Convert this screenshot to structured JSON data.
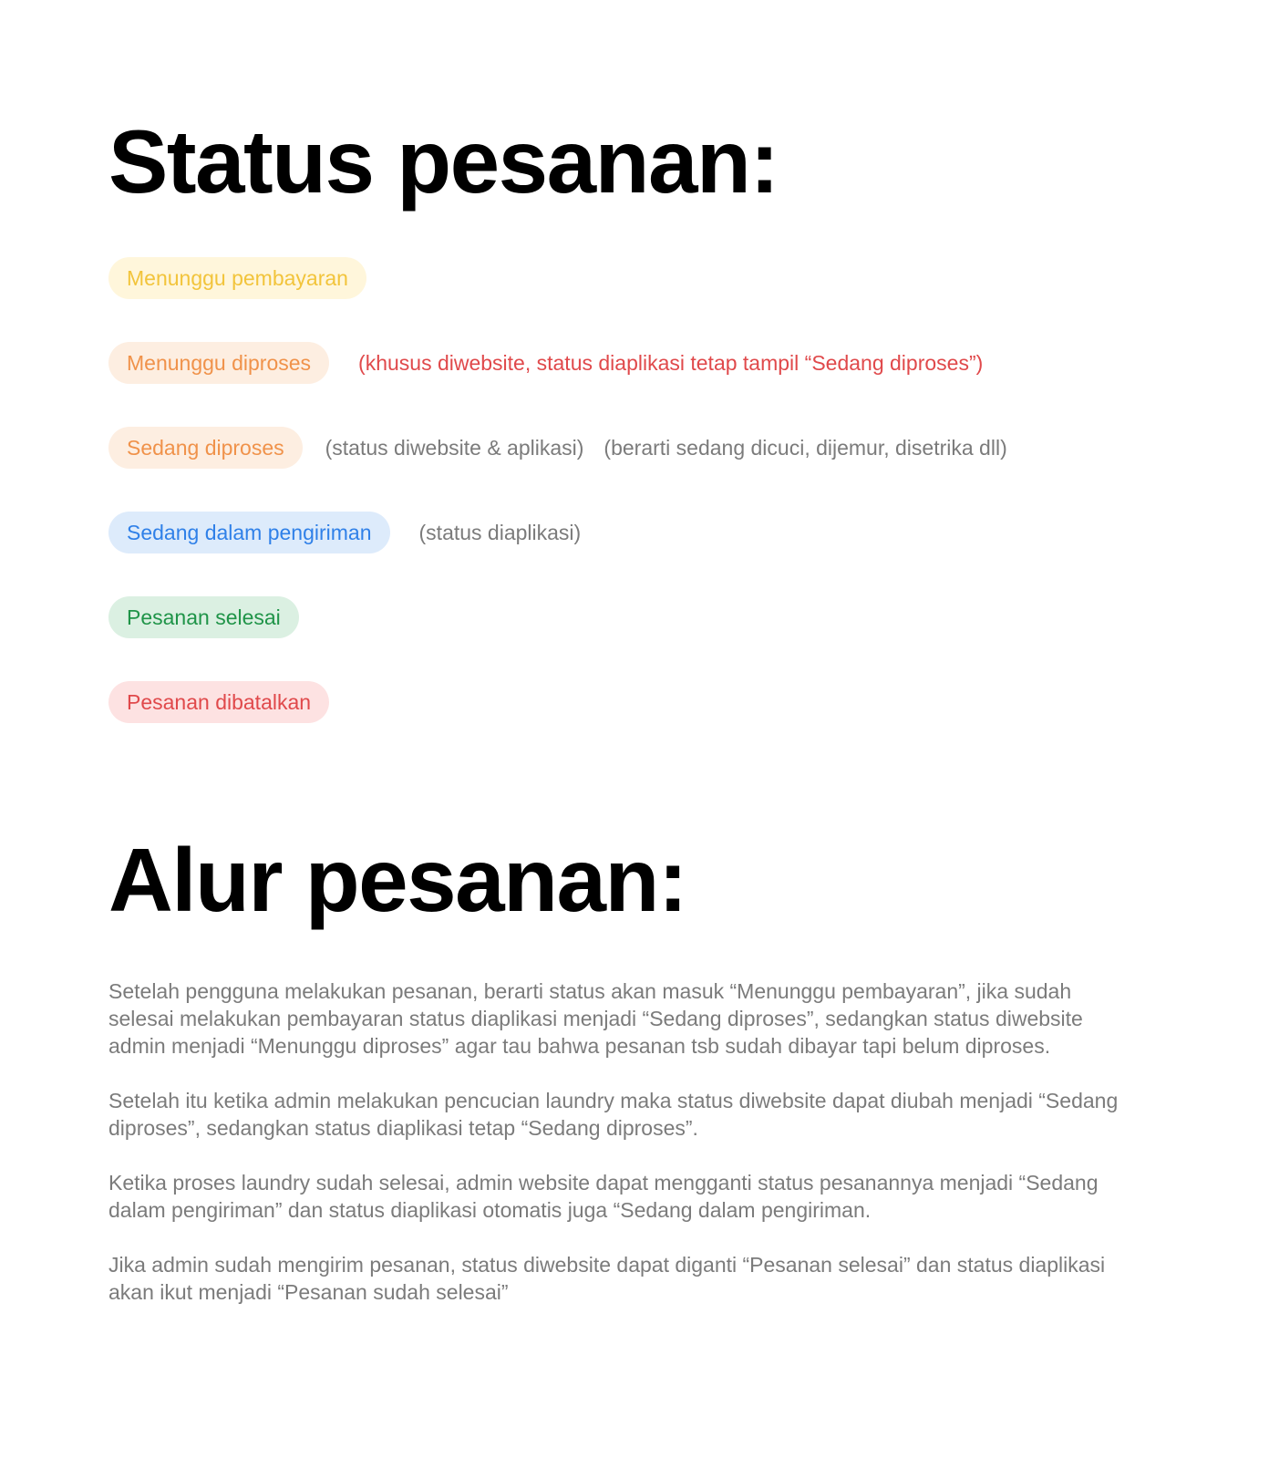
{
  "status_section": {
    "title": "Status pesanan:",
    "items": [
      {
        "label": "Menunggu pembayaran",
        "text_color": "#f2c43b",
        "bg_color": "#fff6db",
        "notes": []
      },
      {
        "label": "Menunggu diproses",
        "text_color": "#f0924a",
        "bg_color": "#fdeee1",
        "notes": [
          "(khusus diwebsite, status diaplikasi tetap tampil “Sedang diproses”)"
        ]
      },
      {
        "label": "Sedang diproses",
        "text_color": "#f0924a",
        "bg_color": "#fdeee1",
        "notes": [
          "(status diwebsite & aplikasi)",
          "(berarti sedang dicuci, dijemur, disetrika dll)"
        ]
      },
      {
        "label": "Sedang dalam pengiriman",
        "text_color": "#2f80e8",
        "bg_color": "#ddebfb",
        "notes": [
          "(status diaplikasi)"
        ]
      },
      {
        "label": "Pesanan selesai",
        "text_color": "#1f9448",
        "bg_color": "#dbf0e2",
        "notes": []
      },
      {
        "label": "Pesanan dibatalkan",
        "text_color": "#e0494b",
        "bg_color": "#fde2e2",
        "notes": []
      }
    ]
  },
  "flow_section": {
    "title": "Alur pesanan:",
    "paragraphs": [
      "Setelah pengguna melakukan pesanan, berarti status akan masuk “Menunggu pembayaran”, jika sudah selesai melakukan pembayaran status diaplikasi menjadi “Sedang diproses”, sedangkan status diwebsite admin menjadi “Menunggu diproses” agar tau bahwa pesanan tsb sudah dibayar tapi belum diproses.",
      "Setelah itu ketika admin melakukan pencucian laundry maka status diwebsite dapat diubah menjadi “Sedang diproses”, sedangkan status diaplikasi tetap “Sedang diproses”.",
      "Ketika proses laundry sudah selesai, admin website dapat mengganti status pesanannya menjadi “Sedang dalam pengiriman” dan status diaplikasi otomatis juga “Sedang dalam pengiriman.",
      "Jika admin sudah mengirim pesanan, status diwebsite dapat diganti “Pesanan selesai” dan status diaplikasi akan ikut menjadi “Pesanan sudah selesai”"
    ]
  },
  "colors": {
    "note_gray": "#7b7b7b",
    "note_red": "#e0494b",
    "heading": "#000000"
  }
}
